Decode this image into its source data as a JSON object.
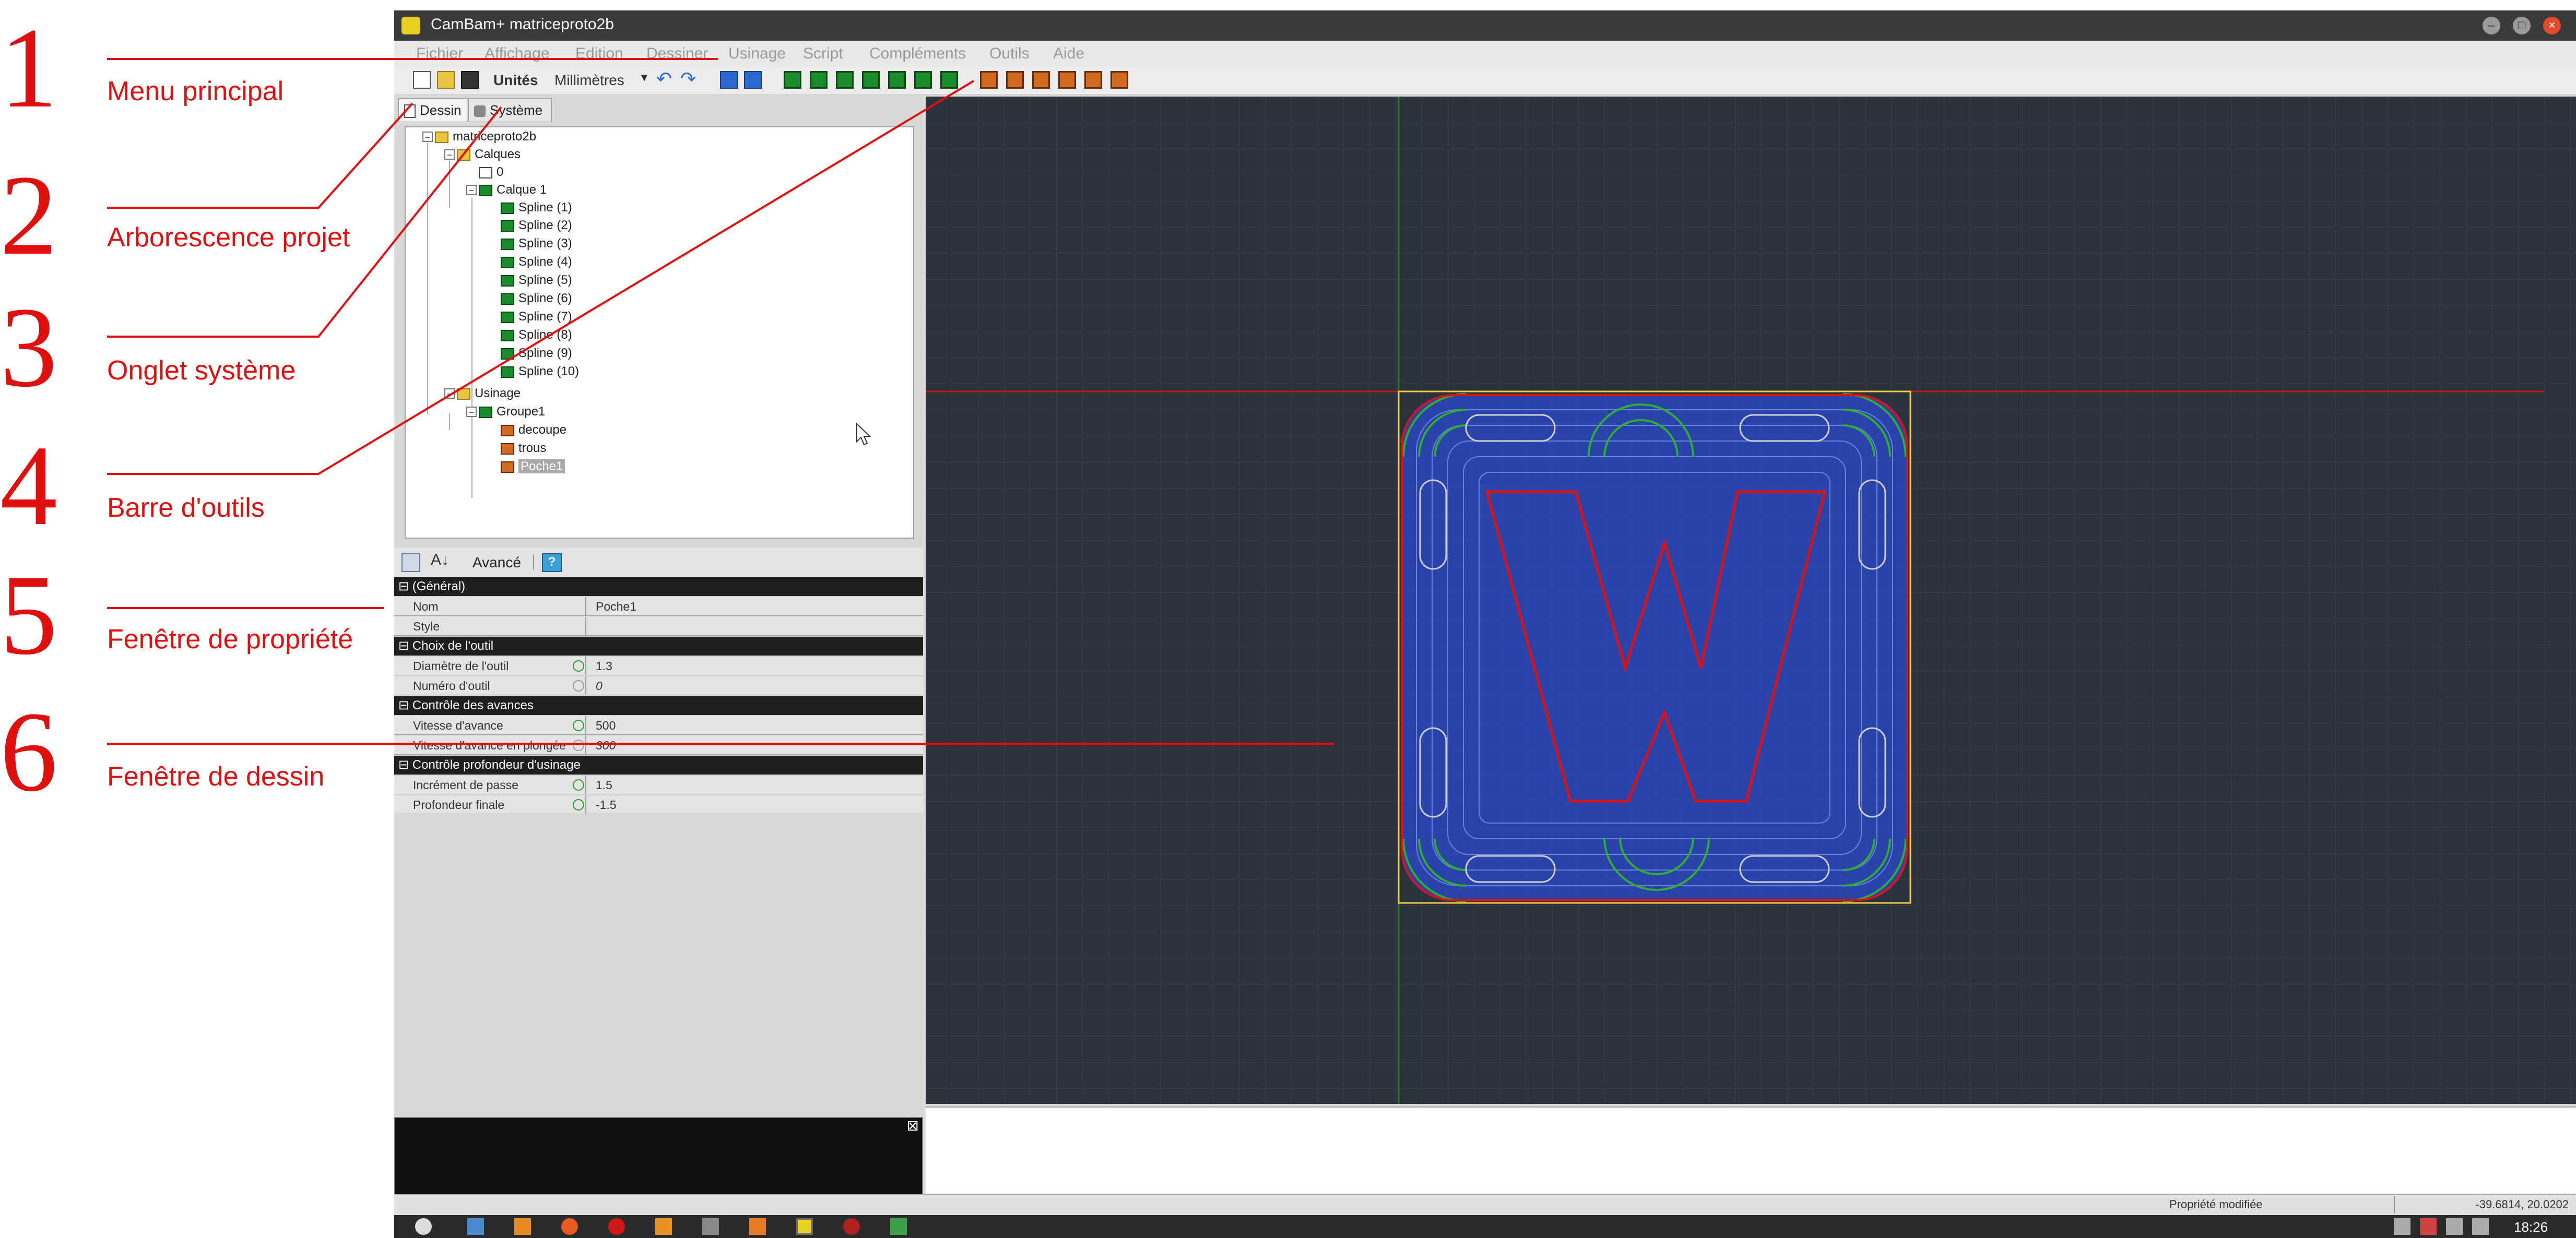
{
  "annotations": [
    {
      "number": "1",
      "label": "Menu principal"
    },
    {
      "number": "2",
      "label": "Arborescence projet"
    },
    {
      "number": "3",
      "label": "Onglet système"
    },
    {
      "number": "4",
      "label": "Barre d'outils"
    },
    {
      "number": "5",
      "label": "Fenêtre de propriété"
    },
    {
      "number": "6",
      "label": "Fenêtre de dessin"
    }
  ],
  "colors": {
    "annotation": "#e01010",
    "canvas_bg": "#2c313a",
    "grid": "#3c424d",
    "toolpath_blue": "#2a46b8",
    "toolpath_green": "#2fae2f",
    "shape_red": "#e01010",
    "stock_yellow": "#e8d040"
  },
  "window": {
    "title": "CamBam+ matriceproto2b"
  },
  "menu": [
    "Fichier",
    "Affichage",
    "Edition",
    "Dessiner",
    "Usinage",
    "Script",
    "Compléments",
    "Outils",
    "Aide"
  ],
  "toolbar": {
    "units_label": "Unités",
    "units_value": "Millimètres"
  },
  "tabs": {
    "drawing": "Dessin",
    "system": "Système"
  },
  "tree": {
    "root": "matriceproto2b",
    "layers": "Calques",
    "layer0": "0",
    "layer1": "Calque 1",
    "splines": [
      "Spline (1)",
      "Spline (2)",
      "Spline (3)",
      "Spline (4)",
      "Spline (5)",
      "Spline (6)",
      "Spline (7)",
      "Spline (8)",
      "Spline (9)",
      "Spline (10)"
    ],
    "machining": "Usinage",
    "group": "Groupe1",
    "ops": [
      "decoupe",
      "trous",
      "Poche1"
    ]
  },
  "props_toolbar": {
    "advanced": "Avancé",
    "sort_icon": "sort-alpha-icon",
    "help_icon": "help-icon"
  },
  "properties": {
    "cat_general": "(Général)",
    "name_label": "Nom",
    "name_value": "Poche1",
    "style_label": "Style",
    "style_value": "",
    "cat_tool": "Choix de l'outil",
    "tool_diameter_label": "Diamètre de l'outil",
    "tool_diameter_value": "1.3",
    "tool_number_label": "Numéro d'outil",
    "tool_number_value": "0",
    "cat_feed": "Contrôle des avances",
    "feed_rate_label": "Vitesse d'avance",
    "feed_rate_value": "500",
    "plunge_rate_label": "Vitesse d'avance en plongée",
    "plunge_rate_value": "300",
    "cat_depth": "Contrôle profondeur d'usinage",
    "depth_increment_label": "Incrément de passe",
    "depth_increment_value": "1.5",
    "target_depth_label": "Profondeur finale",
    "target_depth_value": "-1.5"
  },
  "status": {
    "message": "Propriété modifiée",
    "coords": "-39.6814, 20.0202"
  },
  "taskbar": {
    "clock": "18:26"
  }
}
